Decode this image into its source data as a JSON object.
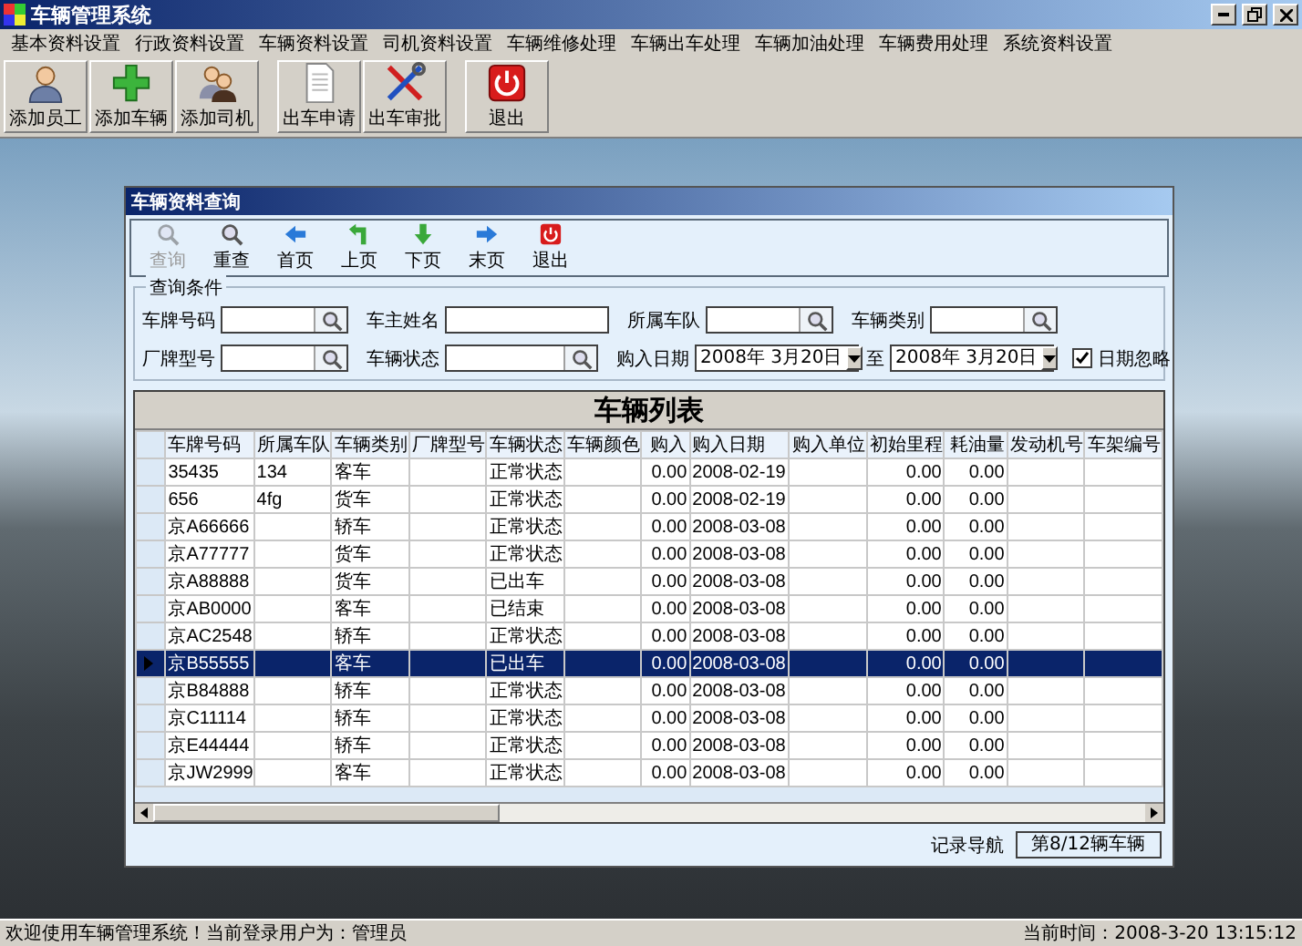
{
  "window": {
    "title": "车辆管理系统"
  },
  "menu": [
    "基本资料设置",
    "行政资料设置",
    "车辆资料设置",
    "司机资料设置",
    "车辆维修处理",
    "车辆出车处理",
    "车辆加油处理",
    "车辆费用处理",
    "系统资料设置"
  ],
  "toolbar": [
    [
      {
        "label": "添加员工"
      },
      {
        "label": "添加车辆"
      },
      {
        "label": "添加司机"
      }
    ],
    [
      {
        "label": "出车申请"
      },
      {
        "label": "出车审批"
      }
    ],
    [
      {
        "label": "退出"
      }
    ]
  ],
  "child_window": {
    "title": "车辆资料查询",
    "toolbar": [
      {
        "label": "查询",
        "disabled": true
      },
      {
        "label": "重查",
        "disabled": false
      },
      {
        "label": "首页",
        "disabled": false
      },
      {
        "label": "上页",
        "disabled": false
      },
      {
        "label": "下页",
        "disabled": false
      },
      {
        "label": "末页",
        "disabled": false
      },
      {
        "label": "退出",
        "disabled": false
      }
    ],
    "query": {
      "title": "查询条件",
      "rows": [
        [
          {
            "label": "车牌号码",
            "kind": "lookup"
          },
          {
            "label": "车主姓名",
            "kind": "text"
          },
          {
            "label": "所属车队",
            "kind": "lookup"
          },
          {
            "label": "车辆类别",
            "kind": "lookup"
          }
        ],
        [
          {
            "label": "厂牌型号",
            "kind": "lookup"
          },
          {
            "label": "车辆状态",
            "kind": "lookup"
          },
          {
            "label": "购入日期",
            "kind": "date",
            "value": "2008年 3月20日"
          },
          {
            "label": "至",
            "kind": "date",
            "value": "2008年 3月20日"
          }
        ]
      ],
      "checkbox": {
        "label": "日期忽略",
        "checked": true
      }
    },
    "grid": {
      "title": "车辆列表",
      "columns": [
        "车牌号码",
        "所属车队",
        "车辆类别",
        "厂牌型号",
        "车辆状态",
        "车辆颜色",
        "购入",
        "购入日期",
        "购入单位",
        "初始里程",
        "耗油量",
        "发动机号",
        "车架编号"
      ],
      "rows": [
        {
          "plate": "35435",
          "fleet": "134",
          "category": "客车",
          "status": "正常状态",
          "price": "0.00",
          "date": "2008-02-19",
          "mileage": "0.00",
          "fuel": "0.00",
          "selected": false
        },
        {
          "plate": "656",
          "fleet": "4fg",
          "category": "货车",
          "status": "正常状态",
          "price": "0.00",
          "date": "2008-02-19",
          "mileage": "0.00",
          "fuel": "0.00",
          "selected": false
        },
        {
          "plate": "京A66666",
          "category": "轿车",
          "status": "正常状态",
          "price": "0.00",
          "date": "2008-03-08",
          "mileage": "0.00",
          "fuel": "0.00",
          "selected": false
        },
        {
          "plate": "京A77777",
          "category": "货车",
          "status": "正常状态",
          "price": "0.00",
          "date": "2008-03-08",
          "mileage": "0.00",
          "fuel": "0.00",
          "selected": false
        },
        {
          "plate": "京A88888",
          "category": "货车",
          "status": "已出车",
          "price": "0.00",
          "date": "2008-03-08",
          "mileage": "0.00",
          "fuel": "0.00",
          "selected": false
        },
        {
          "plate": "京AB0000",
          "category": "客车",
          "status": "已结束",
          "price": "0.00",
          "date": "2008-03-08",
          "mileage": "0.00",
          "fuel": "0.00",
          "selected": false
        },
        {
          "plate": "京AC2548",
          "category": "轿车",
          "status": "正常状态",
          "price": "0.00",
          "date": "2008-03-08",
          "mileage": "0.00",
          "fuel": "0.00",
          "selected": false
        },
        {
          "plate": "京B55555",
          "category": "客车",
          "status": "已出车",
          "price": "0.00",
          "date": "2008-03-08",
          "mileage": "0.00",
          "fuel": "0.00",
          "selected": true
        },
        {
          "plate": "京B84888",
          "category": "轿车",
          "status": "正常状态",
          "price": "0.00",
          "date": "2008-03-08",
          "mileage": "0.00",
          "fuel": "0.00",
          "selected": false
        },
        {
          "plate": "京C11114",
          "category": "轿车",
          "status": "正常状态",
          "price": "0.00",
          "date": "2008-03-08",
          "mileage": "0.00",
          "fuel": "0.00",
          "selected": false
        },
        {
          "plate": "京E44444",
          "category": "轿车",
          "status": "正常状态",
          "price": "0.00",
          "date": "2008-03-08",
          "mileage": "0.00",
          "fuel": "0.00",
          "selected": false
        },
        {
          "plate": "京JW2999",
          "category": "客车",
          "status": "正常状态",
          "price": "0.00",
          "date": "2008-03-08",
          "mileage": "0.00",
          "fuel": "0.00",
          "selected": false
        }
      ]
    },
    "navigation": {
      "label": "记录导航",
      "value": "第8/12辆车辆"
    }
  },
  "status_bar": {
    "message": "欢迎使用车辆管理系统！当前登录用户为：管理员",
    "time": "当前时间：2008-3-20 13:15:12"
  }
}
